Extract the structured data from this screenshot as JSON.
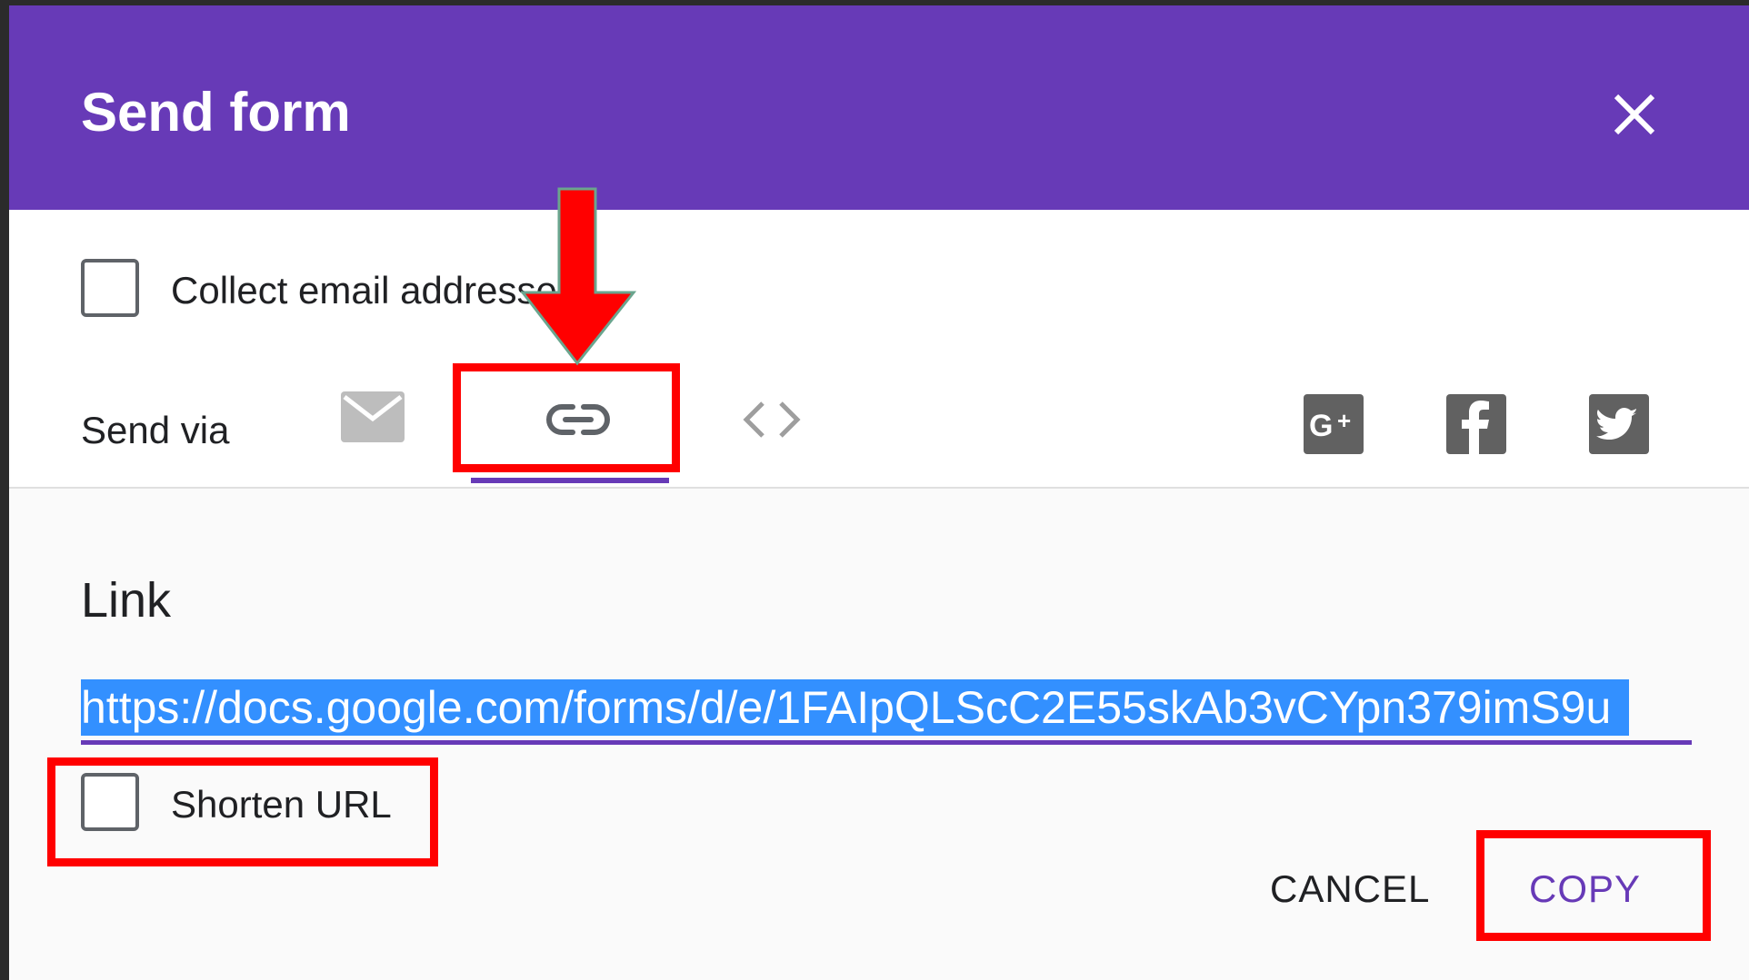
{
  "dialog": {
    "title": "Send form",
    "collect_email_label": "Collect email addresses",
    "send_via_label": "Send via",
    "link_heading": "Link",
    "link_url": "https://docs.google.com/forms/d/e/1FAIpQLScC2E55skAb3vCYpn379imS9u",
    "shorten_url_label": "Shorten URL",
    "cancel_label": "CANCEL",
    "copy_label": "COPY"
  },
  "send_via_tabs": [
    {
      "icon": "email-icon"
    },
    {
      "icon": "link-icon",
      "selected": true
    },
    {
      "icon": "embed-code-icon"
    }
  ],
  "share_icons": [
    "google-plus-icon",
    "facebook-icon",
    "twitter-icon"
  ],
  "colors": {
    "header": "#673ab7",
    "accent": "#673ab7",
    "selection": "#3390ff",
    "annotation": "#ff0000"
  }
}
